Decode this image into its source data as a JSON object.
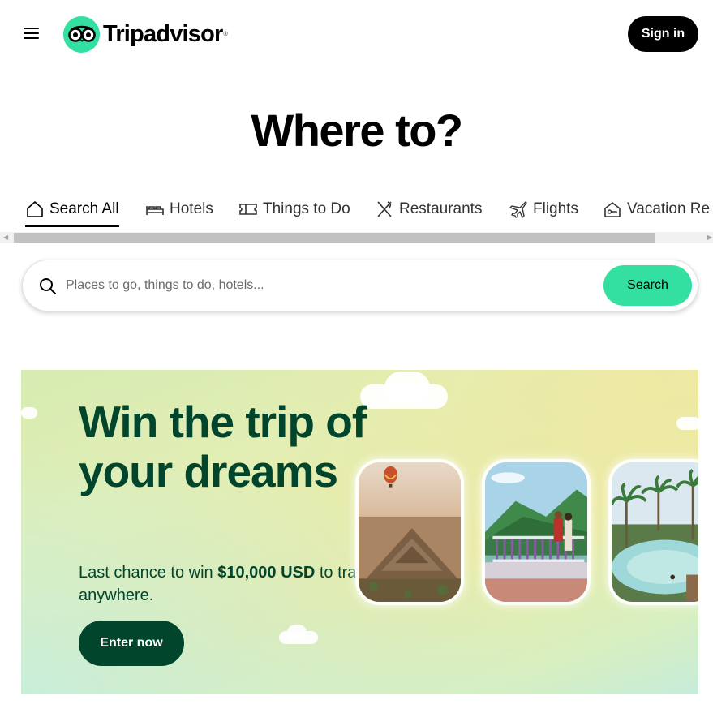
{
  "header": {
    "menu_icon": "hamburger-menu-icon",
    "logo_icon": "owl-eyes-icon",
    "logo_text": "Tripadvisor",
    "logo_reg": "®",
    "signin_label": "Sign in"
  },
  "hero": {
    "title": "Where to?"
  },
  "tabs": [
    {
      "label": "Search All",
      "icon": "house-icon",
      "active": true
    },
    {
      "label": "Hotels",
      "icon": "bed-icon",
      "active": false
    },
    {
      "label": "Things to Do",
      "icon": "ticket-icon",
      "active": false
    },
    {
      "label": "Restaurants",
      "icon": "fork-knife-icon",
      "active": false
    },
    {
      "label": "Flights",
      "icon": "airplane-icon",
      "active": false
    },
    {
      "label": "Vacation Re",
      "icon": "house-key-icon",
      "active": false
    }
  ],
  "search": {
    "placeholder": "Places to go, things to do, hotels...",
    "value": "",
    "button_label": "Search",
    "icon": "magnifier-icon"
  },
  "promo": {
    "title": "Win the trip of your dreams",
    "sub_prefix": "Last chance to win ",
    "sub_amount": "$10,000 USD",
    "sub_suffix": " to travel anywhere.",
    "button_label": "Enter now",
    "photos": [
      "pyramid-balloon-photo",
      "mountain-balcony-photo",
      "palm-pool-photo"
    ]
  },
  "colors": {
    "brand_green": "#34e0a1",
    "dark_green": "#00452c",
    "black": "#000000"
  }
}
